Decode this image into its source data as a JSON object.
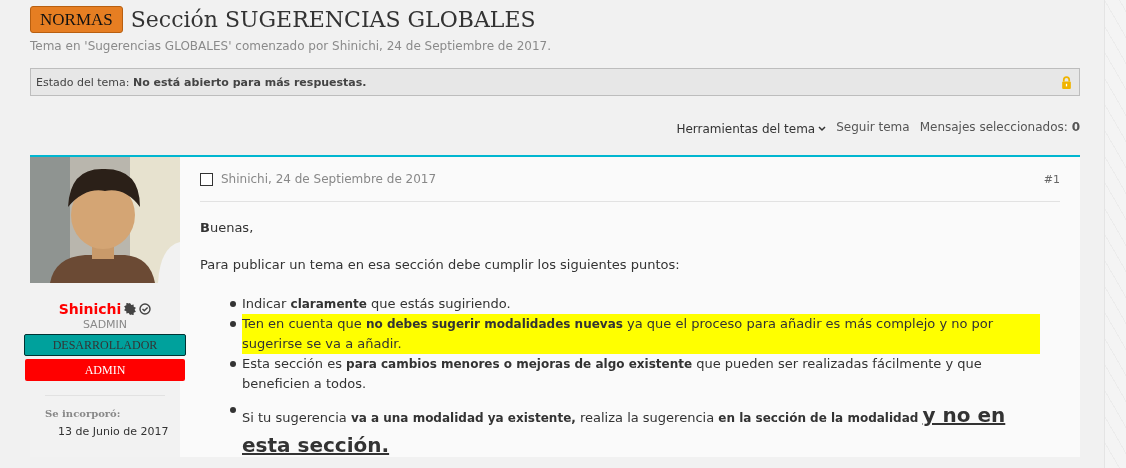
{
  "thread": {
    "prefix": "NORMAS",
    "title": "Sección SUGERENCIAS GLOBALES",
    "meta": "Tema en 'Sugerencias GLOBALES' comenzado por Shinichi, 24 de Septiembre de 2017.",
    "status_label": "Estado del tema:",
    "status_value": "No está abierto para más respuestas.",
    "locked": true
  },
  "tools": {
    "menu": "Herramientas del tema",
    "follow": "Seguir tema",
    "selected_label": "Mensajes seleccionados:",
    "selected_count": "0"
  },
  "author": {
    "name": "Shinichi",
    "title": "SADMIN",
    "banners": [
      {
        "label": "DESARROLLADOR",
        "color": "#00a19c"
      },
      {
        "label": "ADMIN",
        "color": "#ff0000"
      }
    ],
    "joined_label": "Se incorporó:",
    "joined_value": "13 de Junio de 2017"
  },
  "post": {
    "selected": false,
    "byline": "Shinichi, 24 de Septiembre de 2017",
    "number": "#1",
    "paragraphs": [
      "**B**uenas,",
      "Para publicar un tema en esa sección debe cumplir los siguientes puntos:"
    ],
    "bullets": [
      {
        "highlighted": false,
        "segments": [
          {
            "kind": "normal",
            "text": "Indicar "
          },
          {
            "kind": "bold",
            "text": "claramente"
          },
          {
            "kind": "normal",
            "text": " que estás sugiriendo."
          }
        ]
      },
      {
        "highlighted": true,
        "segments": [
          {
            "kind": "normal",
            "text": "Ten en cuenta que "
          },
          {
            "kind": "bold",
            "text": "no debes sugerir modalidades nuevas"
          },
          {
            "kind": "normal",
            "text": " ya que el proceso para añadir es más complejo y no por sugerirse se va a añadir."
          }
        ]
      },
      {
        "highlighted": false,
        "segments": [
          {
            "kind": "normal",
            "text": "Esta sección es "
          },
          {
            "kind": "bold",
            "text": "para cambios menores o mejoras de algo existente"
          },
          {
            "kind": "normal",
            "text": " que pueden ser realizadas fácilmente y que beneficien a todos."
          }
        ]
      },
      {
        "highlighted": false,
        "segments": [
          {
            "kind": "normal",
            "text": "Si tu sugerencia "
          },
          {
            "kind": "bold",
            "text": "va a una modalidad ya existente,"
          },
          {
            "kind": "normal",
            "text": " realiza la sugerencia "
          },
          {
            "kind": "bold",
            "text": "en la sección de la modalidad "
          },
          {
            "kind": "big",
            "text": "y no en esta sección."
          }
        ]
      }
    ]
  }
}
